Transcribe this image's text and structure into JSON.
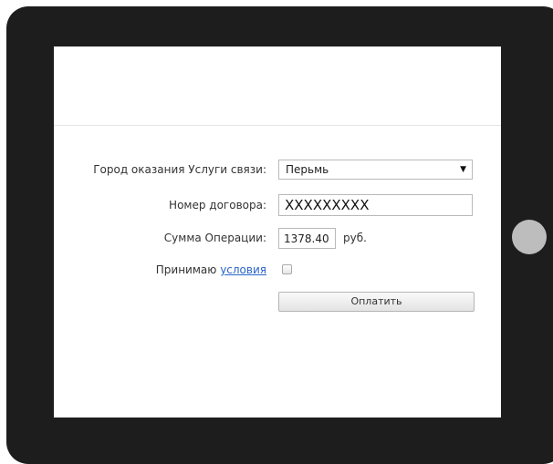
{
  "form": {
    "city_label": "Город оказания Услуги связи:",
    "city_value": "Перьмь",
    "contract_label": "Номер договора:",
    "contract_value": "XXXXXXXXX",
    "amount_label": "Сумма Операции:",
    "amount_value": "1378.40",
    "currency": "руб.",
    "accept_prefix": "Принимаю",
    "accept_link": "условия",
    "accept_checked": false,
    "pay_button": "Оплатить"
  },
  "icons": {
    "select_arrow": "triangle-down-icon"
  },
  "colors": {
    "frame": "#1d1d1d",
    "home_button": "#bdbdbd",
    "link": "#2a64c8"
  }
}
